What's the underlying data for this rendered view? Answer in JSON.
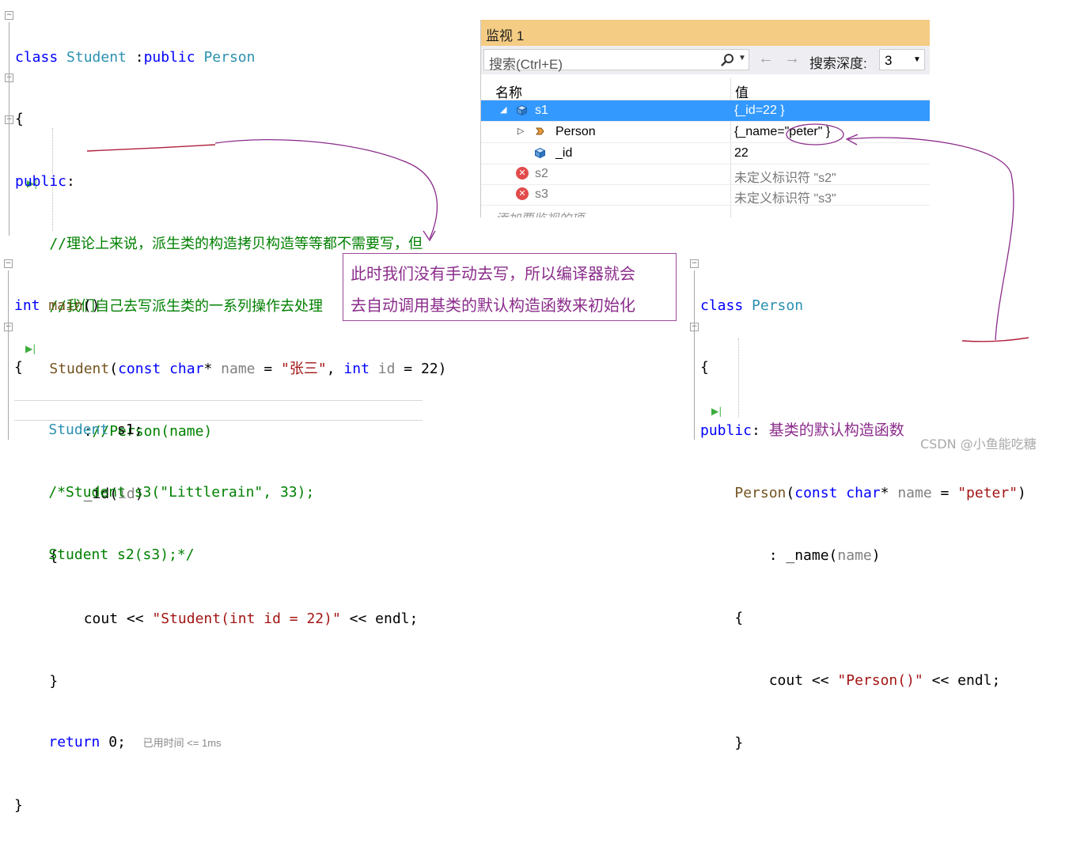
{
  "editor_left": {
    "lines": [
      "class Student :public Person",
      "{",
      "public:",
      "    //理论上来说，派生类的构造拷贝构造等等都不需要写，但",
      "    //我们自己去写派生类的一系列操作去处理",
      "    Student(const char* name = \"张三\", int id = 22)",
      "        ://Person(name)",
      "        _id(id)",
      "    {",
      "        cout << \"Student(int id = 22)\" << endl;",
      "    }"
    ]
  },
  "editor_main": {
    "lines": [
      "int main()",
      "{",
      "    Student s1;",
      "    /*Student s3(\"Littlerain\", 33);",
      "    Student s2(s3);*/",
      "",
      "",
      "    return 0;",
      "}"
    ],
    "perf_hint": "已用时间 <= 1ms"
  },
  "editor_right": {
    "lines": [
      "class Person",
      "{",
      "public: ",
      "    Person(const char* name = \"peter\")",
      "        : _name(name)",
      "    {",
      "        cout << \"Person()\" << endl;",
      "    }"
    ],
    "annotation": "基类的默认构造函数"
  },
  "watch": {
    "title": "监视 1",
    "search_placeholder": "搜索(Ctrl+E)",
    "depth_label": "搜索深度:",
    "depth_value": "3",
    "col_name": "名称",
    "col_value": "值",
    "rows": [
      {
        "name": "s1",
        "value": "{_id=22 }",
        "selected": true
      },
      {
        "name": "Person",
        "value": "{_name=\"peter\" }"
      },
      {
        "name": "_id",
        "value": "22"
      },
      {
        "name": "s2",
        "value": "未定义标识符 \"s2\""
      },
      {
        "name": "s3",
        "value": "未定义标识符 \"s3\""
      }
    ],
    "add_item": "添加要监视的项"
  },
  "note": {
    "line1": "此时我们没有手动去写，所以编译器就会",
    "line2": "去自动调用基类的默认构造函数来初始化"
  },
  "watermark": "CSDN @小鱼能吃糖",
  "colors": {
    "keyword": "#0000ff",
    "type": "#2b91af",
    "comment": "#008000",
    "string": "#a31515",
    "annotation": "#8b2c8b",
    "watch_title": "#f5cc84",
    "selection": "#3399ff"
  }
}
